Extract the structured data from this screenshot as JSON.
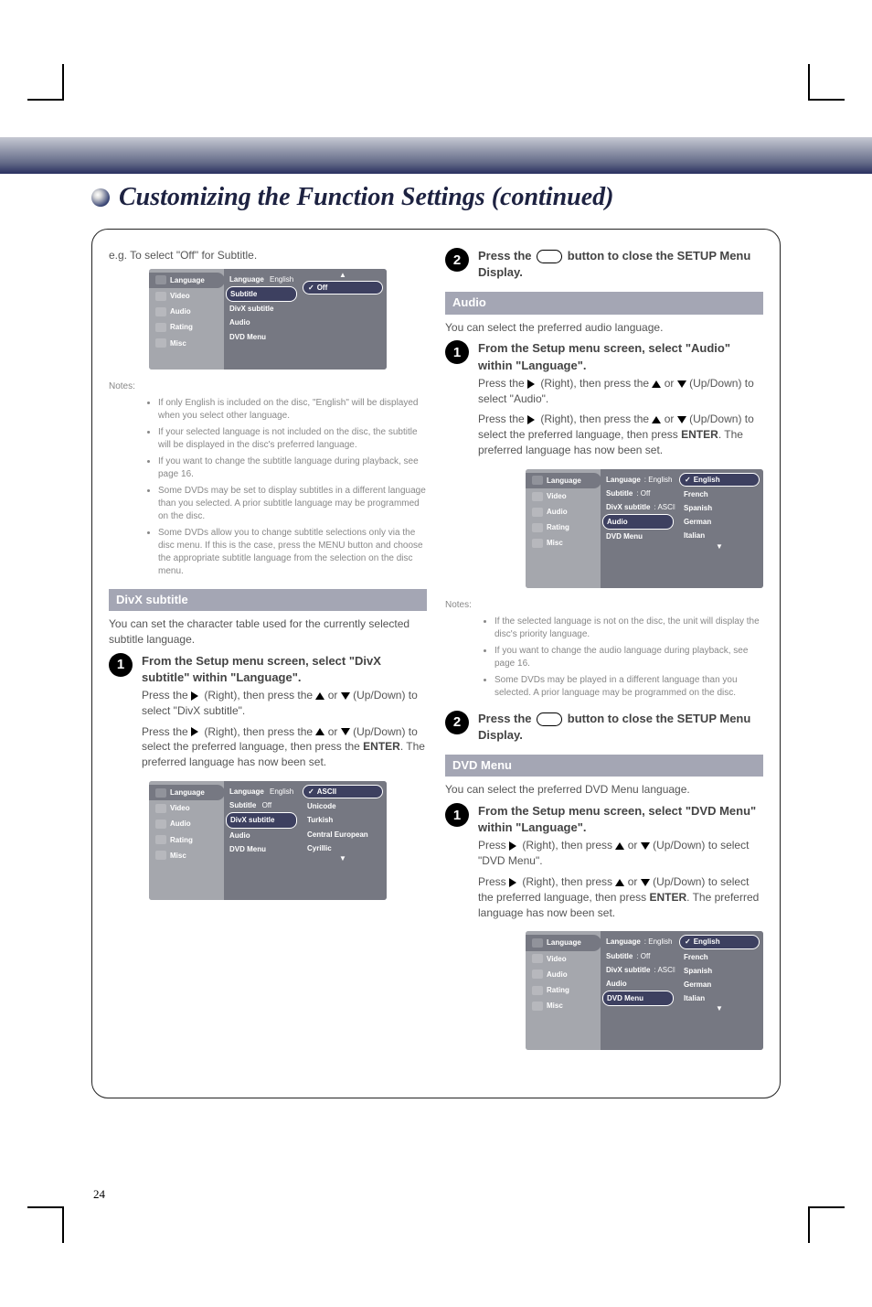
{
  "page": {
    "title": "Customizing the Function Settings (continued)",
    "page_number": "24"
  },
  "col_left": {
    "intro": "e.g. To select \"Off\" for Subtitle.",
    "screenshot1": {
      "sidebar": [
        "Language",
        "Video",
        "Audio",
        "Rating",
        "Misc"
      ],
      "mid_items": [
        "Language",
        "Subtitle",
        "DivX subtitle",
        "Audio",
        "DVD Menu"
      ],
      "mid_value_language": "English",
      "mid_selected": "Subtitle",
      "right_options": [
        "Off"
      ],
      "right_selected": "Off"
    },
    "notes_title": "Notes:",
    "notes": [
      "If only English is included on the disc, \"English\" will be displayed when you select other language.",
      "If your selected language is not included on the disc, the subtitle will be displayed in the disc's preferred language.",
      "If you want to change the subtitle language during playback, see page 16.",
      "Some DVDs may be set to display subtitles in a different language than you selected. A prior subtitle language may be programmed on the disc.",
      "Some DVDs allow you to change subtitle selections only via the disc menu. If this is the case, press the MENU button and choose the appropriate subtitle language from the selection on the disc menu."
    ],
    "heading_divx": "DivX subtitle",
    "divx_intro": "You can set the character table used for the currently selected subtitle language.",
    "step1_title": "From the Setup menu screen, select \"DivX subtitle\" within \"Language\".",
    "step1_body1": "Press the   (Right), then press the   or   (Up/Down) to select \"DivX subtitle\".",
    "step1_body2": "Press the   (Right), then press the   or   (Up/Down) to select the preferred language, then press the ENTER. The preferred language has now been set.",
    "screenshot2": {
      "sidebar": [
        "Language",
        "Video",
        "Audio",
        "Rating",
        "Misc"
      ],
      "mid_items": [
        "Language",
        "Subtitle",
        "DivX subtitle",
        "Audio",
        "DVD Menu"
      ],
      "mid_value_language": "English",
      "mid_value_subtitle": "Off",
      "mid_selected": "DivX subtitle",
      "right_options": [
        "ASCII",
        "Unicode",
        "Turkish",
        "Central European",
        "Cyrillic"
      ],
      "right_selected": "ASCII"
    }
  },
  "col_right": {
    "step2_title": "Press the       button to close the SETUP Menu Display.",
    "heading_audio": "Audio",
    "audio_intro": "You can select the preferred audio language.",
    "step1_title_a": "From the Setup menu screen, select \"Audio\" within \"Language\".",
    "step1_body_a1": "Press the   (Right), then press the   or   (Up/Down) to select \"Audio\".",
    "step1_body_a2": "Press the   (Right), then press the   or   (Up/Down) to select the preferred language, then press ENTER. The preferred language has now been set.",
    "screenshot3": {
      "sidebar": [
        "Language",
        "Video",
        "Audio",
        "Rating",
        "Misc"
      ],
      "mid_items": [
        "Language",
        "Subtitle",
        "DivX subtitle",
        "Audio",
        "DVD Menu"
      ],
      "mid_value_language": ": English",
      "mid_value_subtitle": ": Off",
      "mid_value_divx": ": ASCII",
      "mid_selected": "Audio",
      "right_options": [
        "English",
        "French",
        "Spanish",
        "German",
        "Italian"
      ],
      "right_selected": "English"
    },
    "notes_title": "Notes:",
    "notes_a": [
      "If the selected language is not on the disc, the unit will display the disc's priority language.",
      "If you want to change the audio language during playback, see page 16.",
      "Some DVDs may be played in a different language than you selected. A prior language may be programmed on the disc."
    ],
    "step2_title_a": "Press the       button to close the SETUP Menu Display.",
    "heading_dvdmenu": "DVD Menu",
    "dvdmenu_intro": "You can select the preferred DVD Menu language.",
    "step1_title_d": "From the Setup menu screen, select \"DVD Menu\" within \"Language\".",
    "step1_body_d1": "Press   (Right), then press   or   (Up/Down) to select \"DVD Menu\".",
    "step1_body_d2": "Press   (Right), then press   or   (Up/Down) to select the preferred language, then press ENTER. The preferred language has now been set.",
    "screenshot4": {
      "sidebar": [
        "Language",
        "Video",
        "Audio",
        "Rating",
        "Misc"
      ],
      "mid_items": [
        "Language",
        "Subtitle",
        "DivX subtitle",
        "Audio",
        "DVD Menu"
      ],
      "mid_value_language": ": English",
      "mid_value_subtitle": ": Off",
      "mid_value_divx": ": ASCII",
      "mid_selected": "DVD Menu",
      "right_options": [
        "English",
        "French",
        "Spanish",
        "German",
        "Italian"
      ],
      "right_selected": "English"
    }
  }
}
